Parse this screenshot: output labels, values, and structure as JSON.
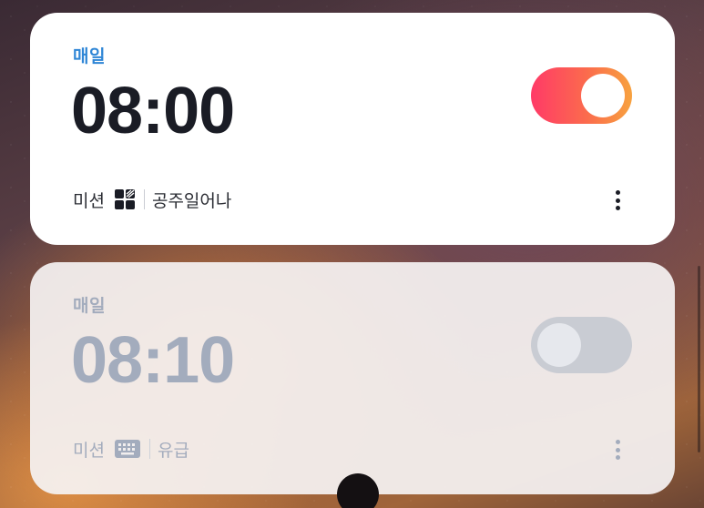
{
  "alarms": [
    {
      "repeat": "매일",
      "time": "08:00",
      "enabled": true,
      "mission_label": "미션",
      "mission_icon": "puzzle-grid-icon",
      "mission_name": "공주일어나"
    },
    {
      "repeat": "매일",
      "time": "08:10",
      "enabled": false,
      "mission_label": "미션",
      "mission_icon": "keyboard-icon",
      "mission_name": "유급"
    }
  ],
  "colors": {
    "accent_blue": "#2f86d6",
    "toggle_on_start": "#ff3a67",
    "toggle_on_end": "#f7a23f",
    "disabled_text": "#a3acbd"
  }
}
